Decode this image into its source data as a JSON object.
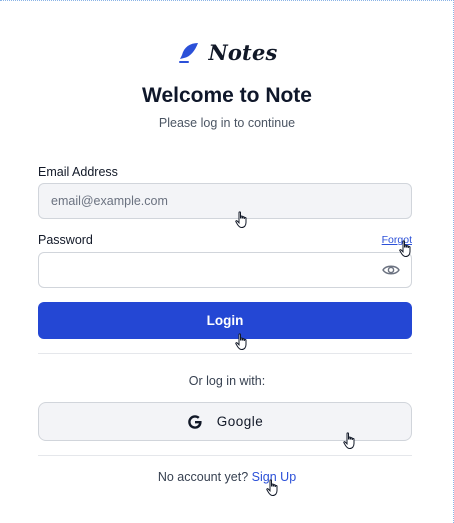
{
  "brand": {
    "name": "Notes",
    "color": "#2b50d8"
  },
  "header": {
    "title": "Welcome to Note",
    "subtitle": "Please log in to continue"
  },
  "form": {
    "email_label": "Email Address",
    "email_placeholder": "email@example.com",
    "email_value": "",
    "password_label": "Password",
    "password_value": "",
    "forgot_label": "Forgot",
    "toggle_visibility_icon": "eye-icon",
    "login_label": "Login"
  },
  "alt_login": {
    "prompt": "Or log in with:",
    "google_label": "Google",
    "google_icon": "google-g-icon"
  },
  "footer": {
    "prompt": "No account yet?",
    "signup_label": "Sign Up"
  },
  "colors": {
    "primary": "#2447d4",
    "link": "#2b50d8",
    "field_bg": "#f3f4f7",
    "border": "#d1d5db"
  },
  "pointer_icon": "hand-pointer-icon"
}
